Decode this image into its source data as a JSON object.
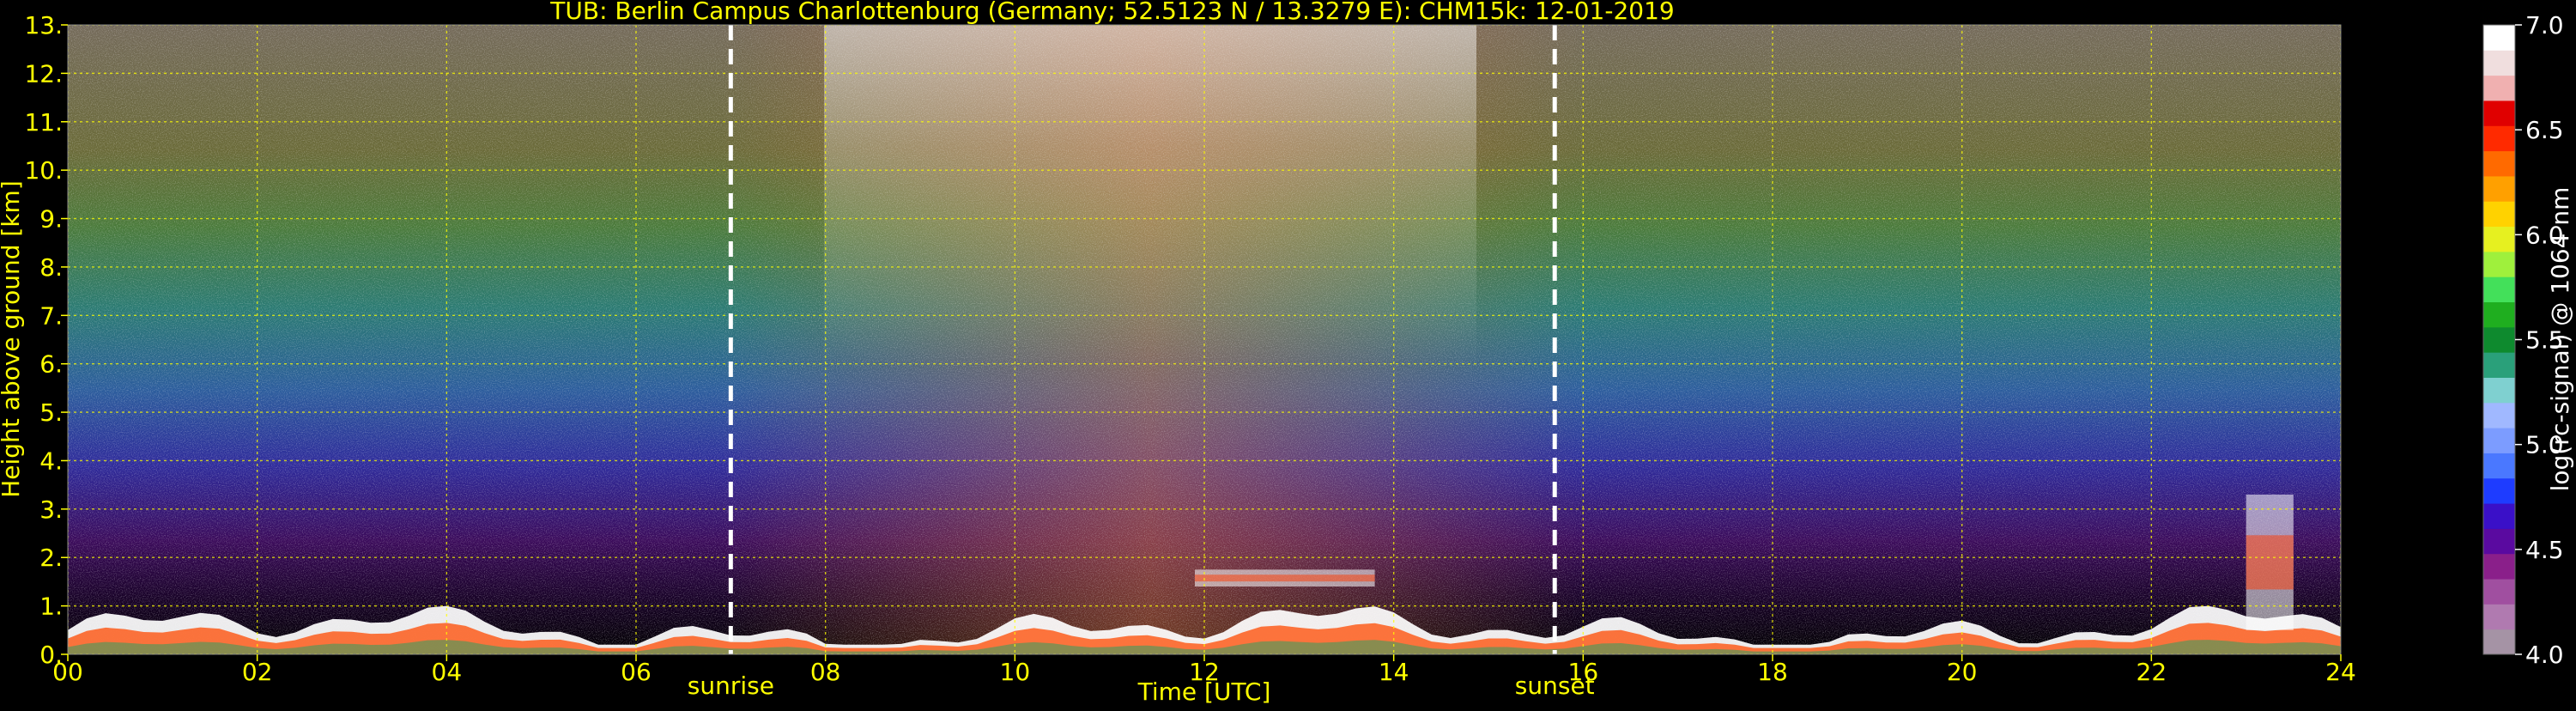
{
  "chart_data": {
    "type": "heatmap",
    "title": "TUB: Berlin Campus Charlottenburg (Germany; 52.5123 N / 13.3279 E):    CHM15k: 12-01-2019",
    "xlabel": "Time [UTC]",
    "ylabel": "Height above ground [km]",
    "xlim": [
      0,
      24
    ],
    "ylim": [
      0,
      13
    ],
    "x_ticks": [
      {
        "value": 0,
        "label": "00"
      },
      {
        "value": 2,
        "label": "02"
      },
      {
        "value": 4,
        "label": "04"
      },
      {
        "value": 6,
        "label": "06"
      },
      {
        "value": 8,
        "label": "08"
      },
      {
        "value": 10,
        "label": "10"
      },
      {
        "value": 12,
        "label": "12"
      },
      {
        "value": 14,
        "label": "14"
      },
      {
        "value": 16,
        "label": "16"
      },
      {
        "value": 18,
        "label": "18"
      },
      {
        "value": 20,
        "label": "20"
      },
      {
        "value": 22,
        "label": "22"
      },
      {
        "value": 24,
        "label": "24"
      }
    ],
    "y_ticks": [
      {
        "value": 0,
        "label": "0."
      },
      {
        "value": 1,
        "label": "1."
      },
      {
        "value": 2,
        "label": "2."
      },
      {
        "value": 3,
        "label": "3."
      },
      {
        "value": 4,
        "label": "4."
      },
      {
        "value": 5,
        "label": "5."
      },
      {
        "value": 6,
        "label": "6."
      },
      {
        "value": 7,
        "label": "7."
      },
      {
        "value": 8,
        "label": "8."
      },
      {
        "value": 9,
        "label": "9."
      },
      {
        "value": 10,
        "label": "10."
      },
      {
        "value": 11,
        "label": "11."
      },
      {
        "value": 12,
        "label": "12."
      },
      {
        "value": 13,
        "label": "13."
      }
    ],
    "grid": true,
    "grid_color": "#ffff00",
    "markers": [
      {
        "label": "sunrise",
        "time": 7.0
      },
      {
        "label": "sunset",
        "time": 15.7
      }
    ],
    "colorbar": {
      "label": "log(rc-signal) @ 1064 nm",
      "min": 4.0,
      "max": 7.0,
      "ticks": [
        {
          "value": 4.0,
          "label": "4.0"
        },
        {
          "value": 4.5,
          "label": "4.5"
        },
        {
          "value": 5.0,
          "label": "5.0"
        },
        {
          "value": 5.5,
          "label": "5.5"
        },
        {
          "value": 6.0,
          "label": "6.0"
        },
        {
          "value": 6.5,
          "label": "6.5"
        },
        {
          "value": 7.0,
          "label": "7.0"
        }
      ],
      "colors": [
        "#a593a5",
        "#b07ab0",
        "#a04fa0",
        "#8a1f8a",
        "#5a0aa0",
        "#3a10c8",
        "#1e3cff",
        "#4a78ff",
        "#7c9cff",
        "#a0b8ff",
        "#7fd0d0",
        "#2aa07a",
        "#0e8a2e",
        "#1fae1f",
        "#43e05a",
        "#9ff03c",
        "#e6f020",
        "#ffd200",
        "#ffa000",
        "#ff6a00",
        "#ff2a00",
        "#e00000",
        "#f0b0b0",
        "#f0dede",
        "#ffffff"
      ]
    },
    "features": [
      {
        "name": "boundary layer",
        "t_start": 0,
        "t_end": 24,
        "height_km_max": 1.0
      },
      {
        "name": "cloud layer",
        "t_start": 11.9,
        "t_end": 13.8,
        "height_km_min": 1.4,
        "height_km_max": 1.75
      },
      {
        "name": "elevated plume",
        "t_start": 23.0,
        "t_end": 23.5,
        "height_km_min": 0.5,
        "height_km_max": 3.3
      }
    ]
  }
}
